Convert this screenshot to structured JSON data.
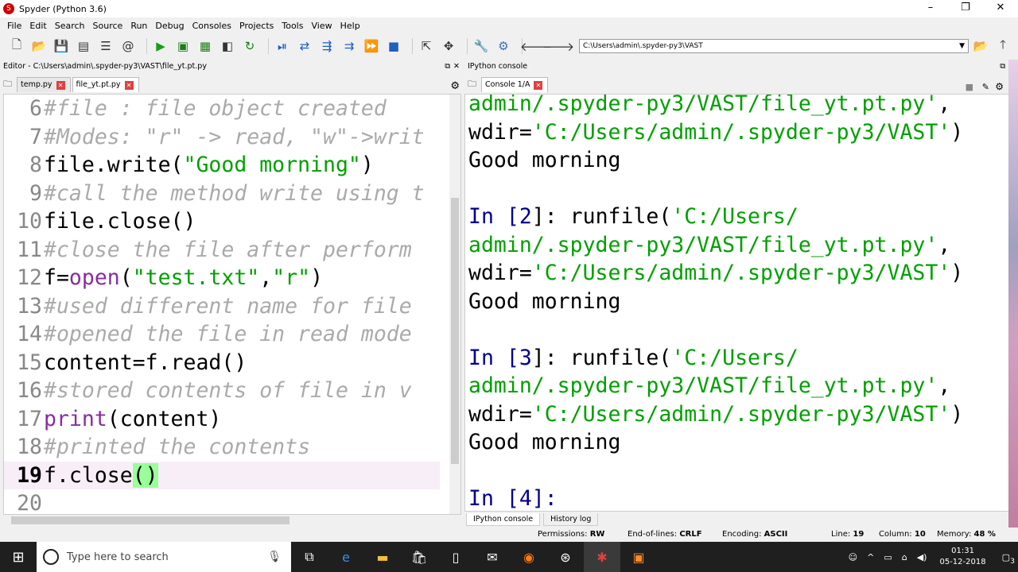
{
  "window": {
    "title": "Spyder (Python 3.6)"
  },
  "menu": [
    "File",
    "Edit",
    "Search",
    "Source",
    "Run",
    "Debug",
    "Consoles",
    "Projects",
    "Tools",
    "View",
    "Help"
  ],
  "toolbar": {
    "path": "C:\\Users\\admin\\.spyder-py3\\VAST"
  },
  "editor": {
    "header": "Editor - C:\\Users\\admin\\.spyder-py3\\VAST\\file_yt.pt.py",
    "tabs": [
      {
        "label": "temp.py"
      },
      {
        "label": "file_yt.pt.py"
      }
    ],
    "lines": [
      {
        "n": "6"
      },
      {
        "n": "7"
      },
      {
        "n": "8"
      },
      {
        "n": "9"
      },
      {
        "n": "10"
      },
      {
        "n": "11"
      },
      {
        "n": "12"
      },
      {
        "n": "13"
      },
      {
        "n": "14"
      },
      {
        "n": "15"
      },
      {
        "n": "16"
      },
      {
        "n": "17"
      },
      {
        "n": "18"
      },
      {
        "n": "19"
      },
      {
        "n": "20"
      }
    ],
    "code": {
      "l6": "#file : file object created",
      "l7": "#Modes: \"r\" -> read, \"w\"->writ",
      "l8a": "file.write(",
      "l8b": "\"Good morning\"",
      "l8c": ")",
      "l9": "#call the method write using t",
      "l10": "file.close()",
      "l11": "#close the file after perform",
      "l12a": "f=",
      "l12b": "open",
      "l12c": "(",
      "l12d": "\"test.txt\"",
      "l12e": ",",
      "l12f": "\"r\"",
      "l12g": ")",
      "l13": "#used different name for file",
      "l14": "#opened the file in read mode",
      "l15": "content=f.read()",
      "l16": "#stored contents of file in  v",
      "l17a": "print",
      "l17b": "(content)",
      "l18": "#printed the contents",
      "l19a": "f.close",
      "l19b": "()"
    }
  },
  "console": {
    "header": "IPython console",
    "tab": "Console 1/A",
    "lines": {
      "c1a": "admin/.spyder-py3/VAST/file_yt.pt.py'",
      "c1b": ",",
      "c2a": "wdir=",
      "c2b": "'C:/Users/admin/.spyder-py3/VAST'",
      "c2c": ")",
      "c3": "Good morning",
      "p2a": "In [",
      "p2b": "2",
      "p2c": "]: runfile(",
      "p2d": "'C:/Users/",
      "c5a": "admin/.spyder-py3/VAST/file_yt.pt.py'",
      "c5b": ",",
      "c6a": "wdir=",
      "c6b": "'C:/Users/admin/.spyder-py3/VAST'",
      "c6c": ")",
      "c7": "Good morning",
      "p3a": "In [",
      "p3b": "3",
      "p3c": "]: runfile(",
      "p3d": "'C:/Users/",
      "c9a": "admin/.spyder-py3/VAST/file_yt.pt.py'",
      "c9b": ",",
      "c10a": "wdir=",
      "c10b": "'C:/Users/admin/.spyder-py3/VAST'",
      "c10c": ")",
      "c11": "Good morning",
      "p4a": "In [",
      "p4b": "4",
      "p4c": "]:"
    },
    "bottom_tabs": [
      "IPython console",
      "History log"
    ]
  },
  "status": {
    "permissions_label": "Permissions:",
    "permissions": "RW",
    "eol_label": "End-of-lines:",
    "eol": "CRLF",
    "enc_label": "Encoding:",
    "enc": "ASCII",
    "line_label": "Line:",
    "line": "19",
    "col_label": "Column:",
    "col": "10",
    "mem_label": "Memory:",
    "mem": "48 %"
  },
  "taskbar": {
    "search_placeholder": "Type here to search",
    "time": "01:31",
    "date": "05-12-2018",
    "notif": "3"
  }
}
